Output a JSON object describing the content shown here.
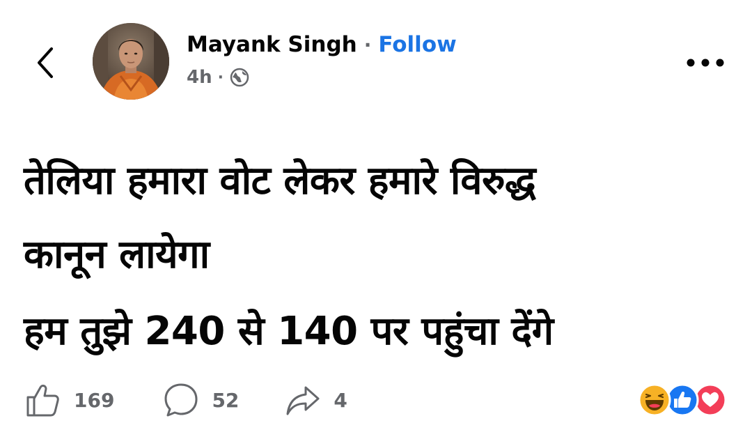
{
  "header": {
    "author_name": "Mayank Singh",
    "separator": "·",
    "follow_label": "Follow",
    "time": "4h",
    "meta_separator": "·",
    "privacy_icon": "globe-icon",
    "back_icon": "chevron-left-icon",
    "more_icon": "more-horizontal-icon"
  },
  "post": {
    "lines": [
      "तेलिया हमारा वोट लेकर हमारे विरुद्ध",
      "कानून लायेगा",
      "हम तुझे 240 से 140 पर पहुंचा देंगे"
    ]
  },
  "actions": {
    "likes": "169",
    "comments": "52",
    "shares": "4"
  },
  "reactions": [
    "haha",
    "like",
    "love"
  ],
  "colors": {
    "follow": "#1b74e4",
    "secondary_text": "#65676b",
    "like_blue": "#1877f2",
    "love_red": "#f33e58",
    "haha_yellow": "#f7b125"
  }
}
